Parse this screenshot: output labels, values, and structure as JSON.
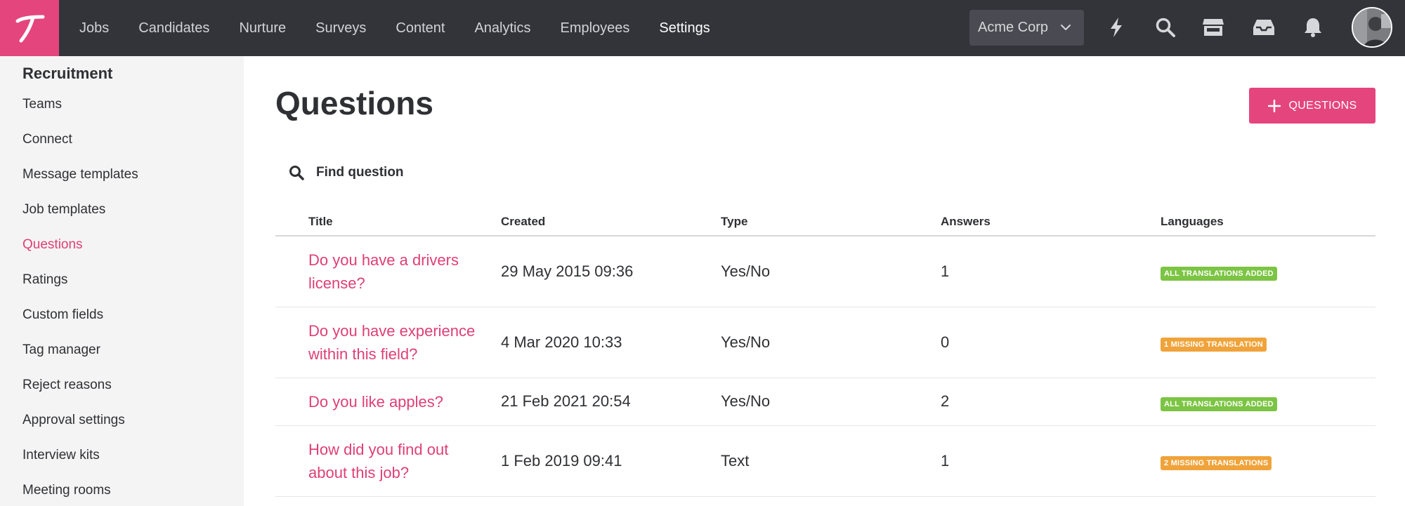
{
  "nav": {
    "items": [
      {
        "label": "Jobs"
      },
      {
        "label": "Candidates"
      },
      {
        "label": "Nurture"
      },
      {
        "label": "Surveys"
      },
      {
        "label": "Content"
      },
      {
        "label": "Analytics"
      },
      {
        "label": "Employees"
      },
      {
        "label": "Settings",
        "active": true
      }
    ],
    "company": "Acme Corp",
    "icons": [
      "bolt-icon",
      "search-icon",
      "store-icon",
      "inbox-icon",
      "bell-icon"
    ],
    "brand_color": "#e4457d"
  },
  "sidebar": {
    "heading": "Recruitment",
    "items": [
      {
        "label": "Teams"
      },
      {
        "label": "Connect"
      },
      {
        "label": "Message templates"
      },
      {
        "label": "Job templates"
      },
      {
        "label": "Questions",
        "active": true
      },
      {
        "label": "Ratings"
      },
      {
        "label": "Custom fields"
      },
      {
        "label": "Tag manager"
      },
      {
        "label": "Reject reasons"
      },
      {
        "label": "Approval settings"
      },
      {
        "label": "Interview kits"
      },
      {
        "label": "Meeting rooms"
      }
    ]
  },
  "main": {
    "title": "Questions",
    "add_button": "QUESTIONS",
    "search_placeholder": "Find question",
    "table": {
      "headers": [
        "Title",
        "Created",
        "Type",
        "Answers",
        "Languages"
      ],
      "rows": [
        {
          "title": "Do you have a drivers license?",
          "created": "29 May 2015 09:36",
          "type": "Yes/No",
          "answers": "1",
          "languages": "ALL TRANSLATIONS ADDED",
          "status_color": "#7cc443"
        },
        {
          "title": "Do you have experience within this field?",
          "created": "4 Mar 2020 10:33",
          "type": "Yes/No",
          "answers": "0",
          "languages": "1 MISSING TRANSLATION",
          "status_color": "#f0a33a"
        },
        {
          "title": "Do you like apples?",
          "created": "21 Feb 2021 20:54",
          "type": "Yes/No",
          "answers": "2",
          "languages": "ALL TRANSLATIONS ADDED",
          "status_color": "#7cc443"
        },
        {
          "title": "How did you find out about this job?",
          "created": "1 Feb 2019 09:41",
          "type": "Text",
          "answers": "1",
          "languages": "2 MISSING TRANSLATIONS",
          "status_color": "#f0a33a"
        }
      ]
    }
  }
}
